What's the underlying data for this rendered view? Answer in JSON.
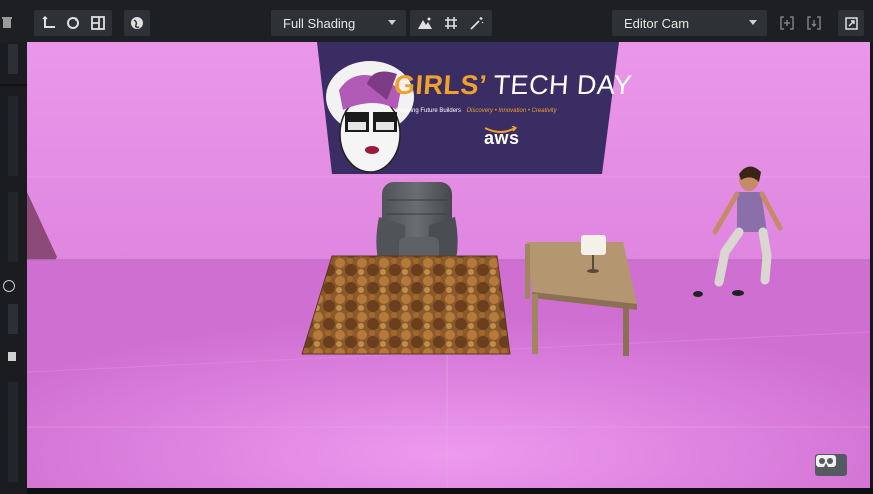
{
  "toolbar": {
    "shading_mode": "Full Shading",
    "camera": "Editor Cam",
    "icons": [
      "transform-icon",
      "rotate-icon",
      "layout-icon",
      "globe-icon",
      "terrain-icon",
      "grid-icon",
      "magic-wand-icon",
      "camera-frame-icon",
      "camera-frame-alt-icon",
      "maximize-icon"
    ]
  },
  "scene": {
    "banner": {
      "title_highlight": "GIRLS’",
      "title_rest": "TECH DAY",
      "tagline": "Inspiring Future Builders",
      "tagline_accent": "Discovery • Innovation • Creativity",
      "sponsor": "aws"
    },
    "objects": [
      "armchair",
      "rug",
      "side-table",
      "table-lamp",
      "character"
    ]
  },
  "colors": {
    "wall": "#e58ee6",
    "floor": "#d77ad9",
    "banner_bg": "#3a2d63",
    "accent": "#f0a12c"
  },
  "overlay": {
    "vr_button_icon": "vr-goggles-icon"
  }
}
